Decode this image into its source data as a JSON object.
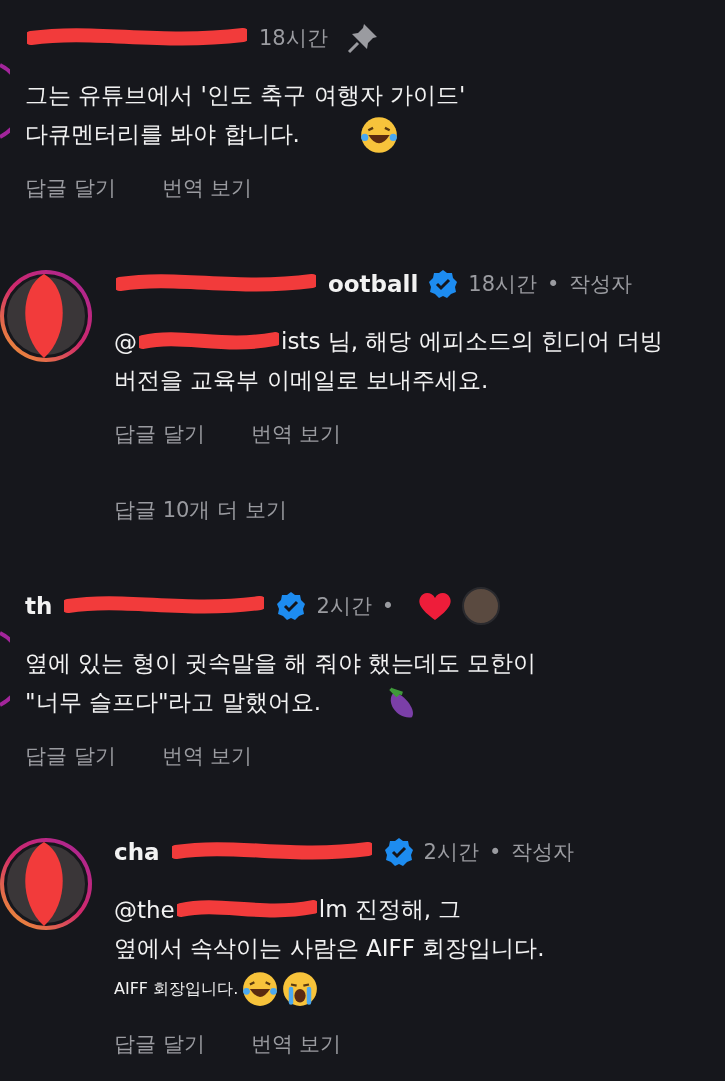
{
  "comments": [
    {
      "kind": "top",
      "username": {
        "redacted": true
      },
      "verified": false,
      "meta": [
        "18시간"
      ],
      "pinned": true,
      "liked_by_author": false,
      "lines": [
        {
          "kind": "normal",
          "text": "그는 유튜브에서 '인도 축구 여행자 가이드'"
        },
        {
          "kind": "normal",
          "text": "다큐멘터리를 봐야 합니다.",
          "emoji": [
            {
              "kind": "laugh"
            }
          ],
          "emoji_far": true
        }
      ],
      "actions": [
        "답글 달기",
        "번역 보기"
      ]
    },
    {
      "kind": "reply",
      "username": {
        "redacted": true,
        "post": "ootball"
      },
      "avatar_redacted": true,
      "verified": true,
      "meta": [
        "18시간",
        "•",
        "작성자"
      ],
      "pinned": false,
      "liked_by_author": false,
      "lines": [
        {
          "kind": "normal",
          "redacted": true,
          "pre": "@",
          "post": "ists 님, 해당 에피소드의 힌디어 더빙"
        },
        {
          "kind": "normal",
          "text": "버전을 교육부 이메일로 보내주세요."
        }
      ],
      "actions": [
        "답글 달기",
        "번역 보기"
      ],
      "more_replies": "답글 10개 더 보기"
    },
    {
      "kind": "top",
      "username": {
        "redacted": true,
        "pre": "th"
      },
      "verified": true,
      "meta": [
        "2시간",
        "•"
      ],
      "pinned": false,
      "liked_by_author": true,
      "lines": [
        {
          "kind": "normal",
          "text": "옆에 있는 형이 귓속말을 해 줘야 했는데도 모한이"
        },
        {
          "kind": "normal",
          "text": "\"너무 슬프다\"라고 말했어요.",
          "emoji": [
            {
              "kind": "eggplant"
            }
          ],
          "emoji_far": true
        }
      ],
      "actions": [
        "답글 달기",
        "번역 보기"
      ]
    },
    {
      "kind": "reply",
      "username": {
        "redacted": true,
        "pre": "cha"
      },
      "avatar_redacted": true,
      "verified": true,
      "meta": [
        "2시간",
        "•",
        "작성자"
      ],
      "pinned": false,
      "liked_by_author": false,
      "lines": [
        {
          "kind": "normal",
          "redacted": true,
          "pre": "@the",
          "post": "lm 진정해, 그"
        },
        {
          "kind": "normal",
          "text": "옆에서 속삭이는 사람은 AIFF 회장입니다."
        },
        {
          "kind": "small",
          "text": "AIFF 회장입니다.",
          "emoji": [
            {
              "kind": "laugh"
            },
            {
              "kind": "cry"
            }
          ]
        }
      ],
      "actions": [
        "답글 달기",
        "번역 보기"
      ]
    }
  ]
}
